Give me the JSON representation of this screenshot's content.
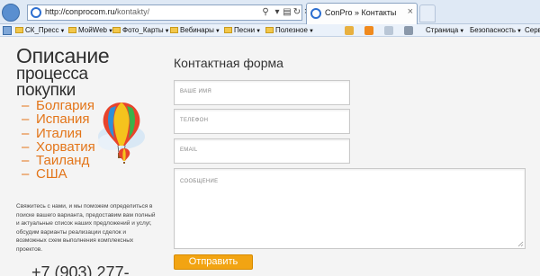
{
  "browser": {
    "url": {
      "domain": "http://conprocom.ru/",
      "path": "kontakty/"
    },
    "tab_title": "ConPro » Контакты",
    "tab_close": "×"
  },
  "favorites": [
    {
      "label": "СК_Пресс"
    },
    {
      "label": "МойWeb"
    },
    {
      "label": "Фото_Карты"
    },
    {
      "label": "Вебинары"
    },
    {
      "label": "Песни"
    },
    {
      "label": "Полезное"
    }
  ],
  "command_bar": {
    "page": "Страница",
    "safety": "Безопасность",
    "service": "Серв"
  },
  "left": {
    "heading_line1": "Описание",
    "heading_line2": "процесса",
    "heading_line3": "покупки",
    "countries": [
      "Болгария",
      "Испания",
      "Италия",
      "Хорватия",
      "Таиланд",
      "США"
    ],
    "description": "Свяжитесь с нами, и мы поможем определиться в поиске вашего варианта, предоставим вам полный и актуальные список наших предложений и услуг, обсудим варианты реализации сделок и возможных схем выполнения комплексных проектов.",
    "phone": "+7 (903) 277-"
  },
  "form": {
    "title": "Контактная форма",
    "name_placeholder": "ВАШЕ ИМЯ",
    "phone_placeholder": "ТЕЛЕФОН",
    "email_placeholder": "EMAIL",
    "message_placeholder": "СООБЩЕНИЕ",
    "submit_label": "Отправить"
  },
  "colors": {
    "accent_orange": "#e37519",
    "button_orange": "#f2a412"
  }
}
